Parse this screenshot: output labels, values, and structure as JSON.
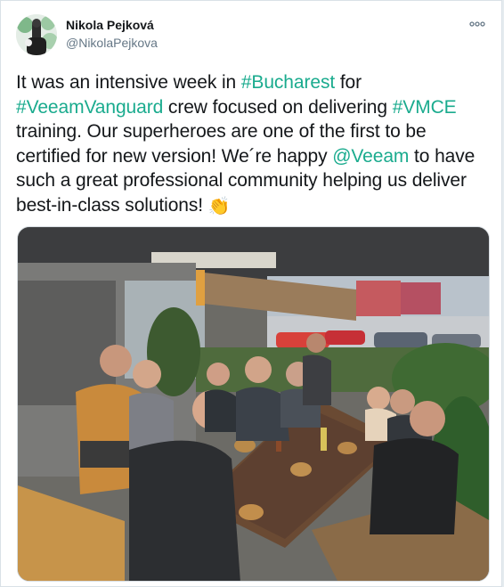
{
  "author": {
    "display_name": "Nikola Pejková",
    "handle": "@NikolaPejkova",
    "avatar_icon": "profile-avatar"
  },
  "menu": {
    "icon": "more-dots-icon"
  },
  "tweet": {
    "parts": [
      {
        "text": "It was an intensive week in ",
        "type": "text"
      },
      {
        "text": "#Bucharest",
        "type": "link"
      },
      {
        "text": " for ",
        "type": "text"
      },
      {
        "text": "#VeeamVanguard",
        "type": "link"
      },
      {
        "text": " crew focused on delivering ",
        "type": "text"
      },
      {
        "text": "#VMCE",
        "type": "link"
      },
      {
        "text": " training. Our superheroes are one of the first to be certified for new version! We´re happy ",
        "type": "text"
      },
      {
        "text": "@Veeam",
        "type": "link"
      },
      {
        "text": " to have such a great professional community helping us deliver best-in-class solutions! ",
        "type": "text"
      }
    ],
    "emoji": "👏",
    "link_color": "#1aab8e"
  },
  "media": {
    "type": "photo",
    "icon": "group-photo-image"
  }
}
